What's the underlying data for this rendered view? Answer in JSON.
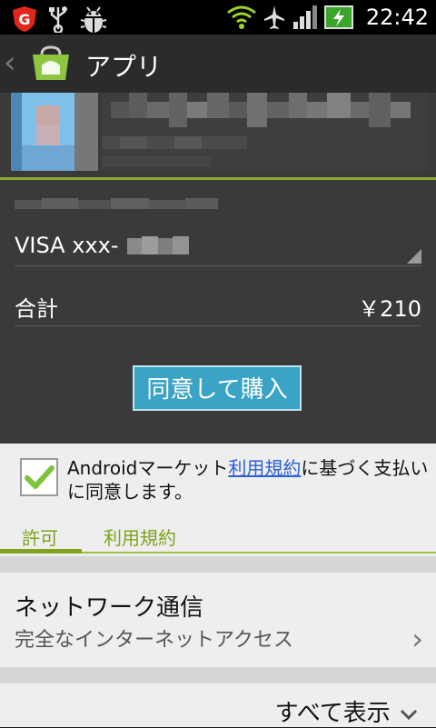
{
  "status_bar": {
    "time": "22:42",
    "icons": [
      "antivirus-g-icon",
      "usb-icon",
      "android-debug-icon",
      "wifi-icon",
      "airplane-icon",
      "signal-icon",
      "battery-charging-icon"
    ]
  },
  "action_bar": {
    "title": "アプリ"
  },
  "purchase": {
    "payment_label": "VISA xxx-",
    "total_label": "合計",
    "total_value": "￥210",
    "buy_label": "同意して購入"
  },
  "agreement": {
    "text_before": "Androidマーケット",
    "link_text": "利用規約",
    "text_after": "に基づく支払いに同意します。",
    "checked": true
  },
  "tabs": {
    "permissions": "許可",
    "terms": "利用規約"
  },
  "permission": {
    "title": "ネットワーク通信",
    "description": "完全なインターネットアクセス"
  },
  "show_all": "すべて表示",
  "colors": {
    "accent_green": "#7fa31d",
    "buy_blue": "#3aa3c6",
    "link_blue": "#2b5fd6"
  }
}
